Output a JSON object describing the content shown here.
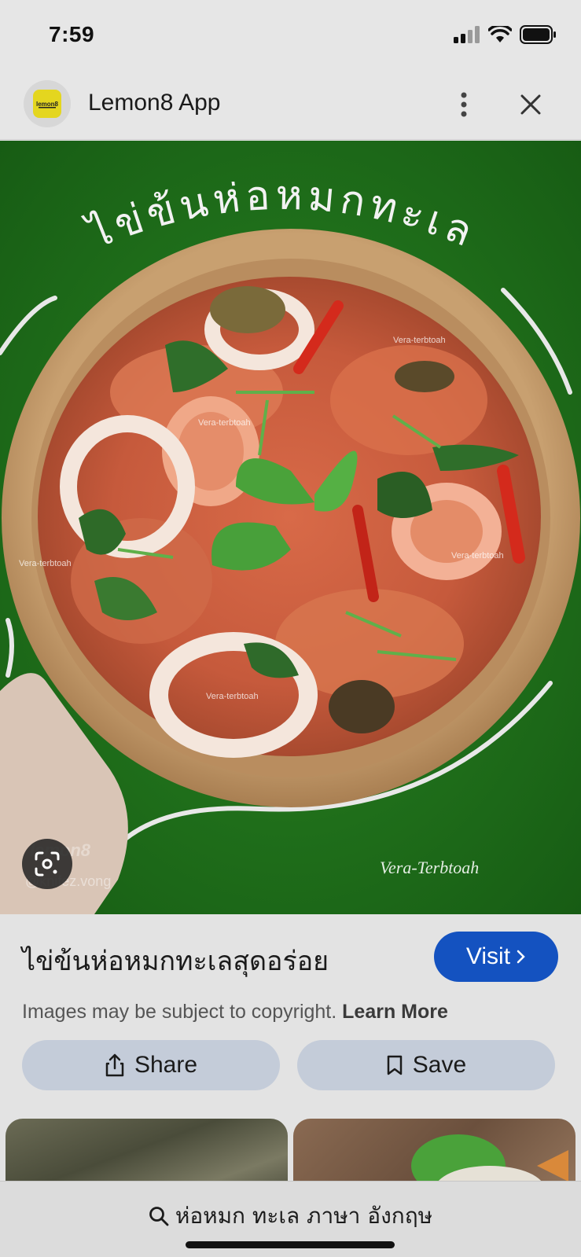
{
  "status_bar": {
    "time": "7:59"
  },
  "header": {
    "app_name": "Lemon8 App",
    "logo_text": "lemon8"
  },
  "hero": {
    "overlay_title": "ไข่ข้นห่อหมกทะเล",
    "watermark": "Vera-Terbtoah",
    "small_watermark": "Vera-terbtoah",
    "source_mark": "lemon8",
    "source_handle": "@knifez.vong"
  },
  "result": {
    "title": "ไข่ข้นห่อหมกทะเลสุดอร่อย",
    "visit_label": "Visit",
    "copyright_text": "Images may be subject to copyright.",
    "learn_more": "Learn More"
  },
  "actions": {
    "share_label": "Share",
    "save_label": "Save"
  },
  "bottom": {
    "search_query": "ห่อหมก ทะเล ภาษา อังกฤษ"
  },
  "colors": {
    "visit": "#1452c0",
    "action_bg": "#c4ccd9",
    "grass": "#2f8a26"
  }
}
